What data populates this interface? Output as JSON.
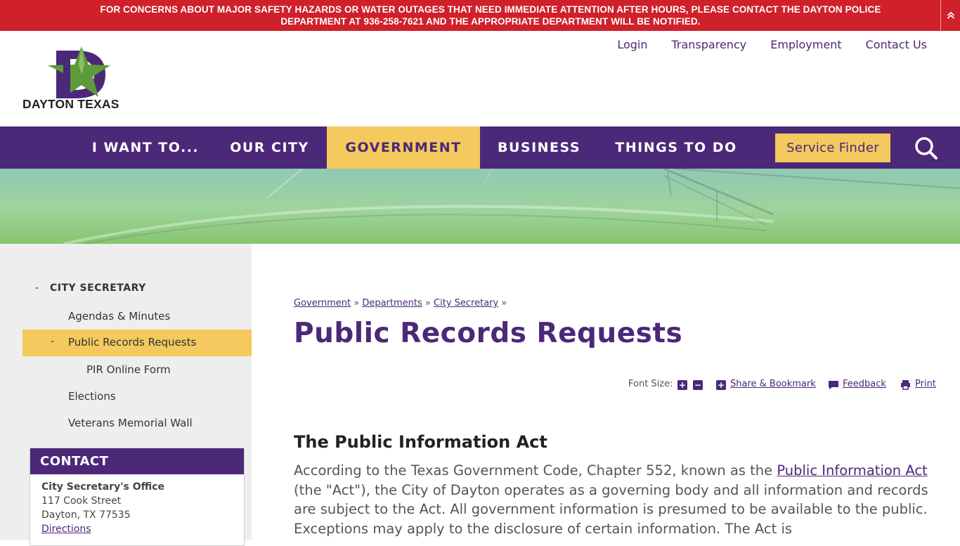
{
  "alert": {
    "line1": "FOR CONCERNS ABOUT MAJOR SAFETY HAZARDS OR WATER OUTAGES THAT NEED IMMEDIATE ATTENTION AFTER HOURS, PLEASE CONTACT THE DAYTON POLICE",
    "line2": "DEPARTMENT AT 936-258-7621 AND THE APPROPRIATE DEPARTMENT WILL BE NOTIFIED."
  },
  "logo": {
    "text": "DAYTON TEXAS",
    "letter": "D"
  },
  "util_nav": [
    "Login",
    "Transparency",
    "Employment",
    "Contact Us"
  ],
  "main_nav": {
    "items": [
      "I WANT TO...",
      "OUR CITY",
      "GOVERNMENT",
      "BUSINESS",
      "THINGS TO DO"
    ],
    "active": "GOVERNMENT",
    "service_finder": "Service Finder"
  },
  "sidebar": {
    "heading": "CITY SECRETARY",
    "items": [
      "Agendas & Minutes",
      "Public Records Requests",
      "PIR Online Form",
      "Elections",
      "Veterans Memorial Wall"
    ],
    "dash": "-"
  },
  "contact": {
    "heading": "CONTACT",
    "office": "City Secretary's Office",
    "street": "117 Cook Street",
    "city": "Dayton, TX 77535",
    "directions": "Directions"
  },
  "breadcrumb": [
    "Government",
    "Departments",
    "City Secretary"
  ],
  "breadcrumb_sep": "»",
  "page_title": "Public Records Requests",
  "tools": {
    "font_size": "Font Size:",
    "plus": "+",
    "minus": "−",
    "share": "Share & Bookmark",
    "feedback": "Feedback",
    "print": "Print"
  },
  "content": {
    "heading": "The Public Information Act",
    "p_before": "According to the Texas Government Code, Chapter 552, known as the ",
    "p_link": "Public Information Act",
    "p_after": " (the \"Act\"), the City of Dayton operates as a governing body and all information and records are subject to the Act. All government information is presumed to be available to the public. Exceptions may apply to the disclosure of certain information. The Act is"
  },
  "colors": {
    "purple": "#4b2878",
    "gold": "#f4c95d",
    "alert_red": "#d0202a",
    "logo_green": "#5f9a3a"
  }
}
